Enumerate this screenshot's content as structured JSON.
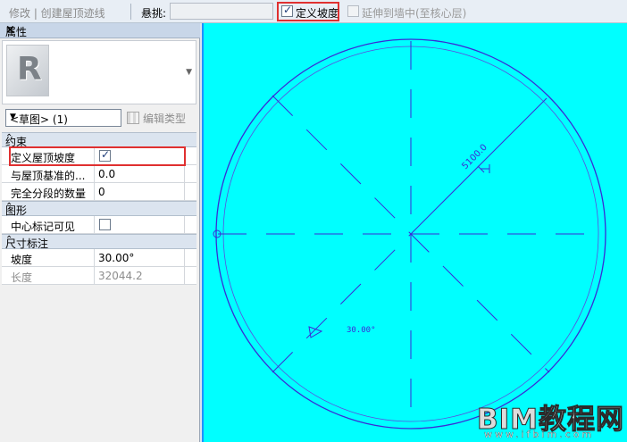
{
  "topbar": {
    "breadcrumb": "修改 | 创建屋顶迹线",
    "overhang_label": "悬挑:",
    "overhang_value": "",
    "define_slope_label": "定义坡度",
    "define_slope_checked": true,
    "extend_label": "延伸到墙中(至核心层)",
    "extend_checked": false
  },
  "panel": {
    "title": "属性",
    "close_glyph": "×",
    "logo_letter": "R",
    "type_selector": "<草图> (1)",
    "edit_type_label": "编辑类型",
    "groups": [
      {
        "label": "约束",
        "caret": "⌃",
        "rows": [
          {
            "key": "定义屋顶坡度",
            "checkbox": true,
            "checked": true
          },
          {
            "key": "与屋顶基准的...",
            "value": "0.0"
          },
          {
            "key": "完全分段的数量",
            "value": "0"
          }
        ]
      },
      {
        "label": "图形",
        "caret": "⌃",
        "rows": [
          {
            "key": "中心标记可见",
            "checkbox": true,
            "checked": false
          }
        ]
      },
      {
        "label": "尺寸标注",
        "caret": "⌃",
        "rows": [
          {
            "key": "坡度",
            "value": "30.00°"
          },
          {
            "key": "长度",
            "value": "32044.2",
            "dim": true
          }
        ]
      }
    ]
  },
  "canvas": {
    "background": "#00ffff",
    "line_color": "#3a2bd6",
    "radius_label": "5100.0",
    "slope_label": "30.00°"
  },
  "watermark": {
    "title": "BIM教程网",
    "url": "www.ifbim.com"
  }
}
